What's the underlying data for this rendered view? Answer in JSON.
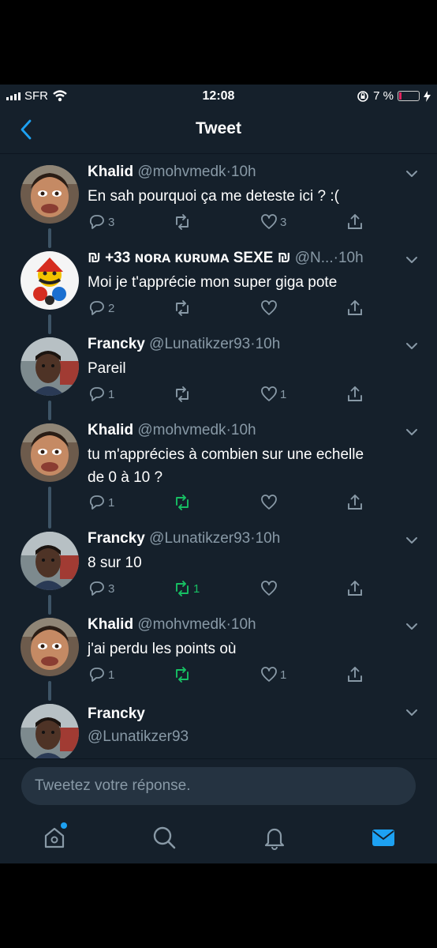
{
  "status": {
    "carrier": "SFR",
    "time": "12:08",
    "battery": "7 %"
  },
  "header": {
    "title": "Tweet"
  },
  "tweets": [
    {
      "name": "Khalid",
      "handle": "@mohvmedk",
      "sep": "·",
      "ago": "10h",
      "lines": [
        "En sah pourquoi ça me deteste ici ? :("
      ],
      "replies": "3",
      "retweets": "",
      "likes": "3",
      "retweeted": false
    },
    {
      "name": "₪ +33 ɴᴏʀᴀ ᴋᴜʀᴜᴍᴀ SEXE ₪",
      "handle": "@N...",
      "sep": "·",
      "ago": "10h",
      "lines": [
        "Moi je t'apprécie mon super giga pote"
      ],
      "replies": "2",
      "retweets": "",
      "likes": "",
      "retweeted": false
    },
    {
      "name": "Francky",
      "handle": "@Lunatikzer93",
      "sep": "·",
      "ago": "10h",
      "lines": [
        "Pareil"
      ],
      "replies": "1",
      "retweets": "",
      "likes": "1",
      "retweeted": false
    },
    {
      "name": "Khalid",
      "handle": "@mohvmedk",
      "sep": "·",
      "ago": "10h",
      "lines": [
        "tu m'apprécies à combien sur une echelle",
        "de 0 à 10 ?"
      ],
      "replies": "1",
      "retweets": "",
      "likes": "",
      "retweeted": true
    },
    {
      "name": "Francky",
      "handle": "@Lunatikzer93",
      "sep": "·",
      "ago": "10h",
      "lines": [
        "8 sur 10"
      ],
      "replies": "3",
      "retweets": "1",
      "likes": "",
      "retweeted": true
    },
    {
      "name": "Khalid",
      "handle": "@mohvmedk",
      "sep": "·",
      "ago": "10h",
      "lines": [
        "j'ai perdu les points où"
      ],
      "replies": "1",
      "retweets": "",
      "likes": "1",
      "retweeted": true
    },
    {
      "name": "Francky",
      "handle": "@Lunatikzer93",
      "sep": "",
      "ago": "",
      "lines": [],
      "replies": "",
      "retweets": "",
      "likes": "",
      "retweeted": false
    }
  ],
  "reply": {
    "placeholder": "Tweetez votre réponse."
  },
  "colors": {
    "background": "#15202b",
    "accent": "#1da1f2",
    "muted": "#8899a6",
    "retweet": "#17bf63",
    "battery_low": "#e0245e"
  },
  "icons": {
    "back": "chevron-left-icon",
    "reply": "reply-icon",
    "retweet": "retweet-icon",
    "like": "heart-icon",
    "share": "share-icon",
    "home": "home-icon",
    "search": "search-icon",
    "notifications": "bell-icon",
    "messages": "mail-icon"
  }
}
